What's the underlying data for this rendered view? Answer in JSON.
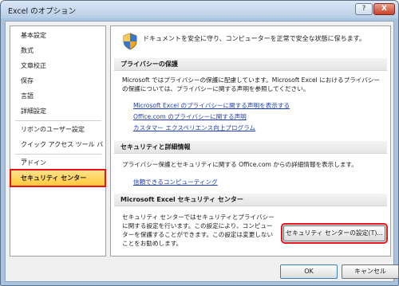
{
  "window": {
    "title": "Excel のオプション",
    "help_label": "?",
    "close_label": "X"
  },
  "sidebar": {
    "items": [
      {
        "label": "基本設定"
      },
      {
        "label": "数式"
      },
      {
        "label": "文章校正"
      },
      {
        "label": "保存"
      },
      {
        "label": "言語"
      },
      {
        "label": "詳細設定"
      },
      {
        "label": "リボンのユーザー設定"
      },
      {
        "label": "クイック アクセス ツール バー"
      },
      {
        "label": "アドイン"
      },
      {
        "label": "セキュリティ センター",
        "selected": true
      }
    ]
  },
  "main": {
    "header_text": "ドキュメントを安全に守り、コンピューターを正常で安全な状態に保ちます。",
    "sections": [
      {
        "title": "プライバシーの保護",
        "body": "Microsoft ではプライバシーの保護に配慮しています。Microsoft Excel におけるプライバシーの保護については、プライバシーに関する声明を参照してください。",
        "links": [
          "Microsoft Excel のプライバシーに関する声明を表示する",
          "Office.com のプライバシーに関する声明",
          "カスタマー エクスペリエンス向上プログラム"
        ]
      },
      {
        "title": "セキュリティと詳細情報",
        "body": "プライバシー保護とセキュリティに関する Office.com からの詳細情報を表示します。",
        "links": [
          "信頼できるコンピューティング"
        ]
      },
      {
        "title": "Microsoft Excel セキュリティ センター",
        "body": "セキュリティ センターではセキュリティとプライバシーに関する設定を行います。この設定により、コンピューターを保護することができます。この設定は変更しないことをお勧めします。",
        "button_label": "セキュリティ センターの設定(T)..."
      }
    ]
  },
  "footer": {
    "ok_label": "OK",
    "cancel_label": "キャンセル"
  },
  "colors": {
    "highlight_outline": "#e8141b",
    "selected_fill": "#ffc93c",
    "link": "#1f3fb0"
  }
}
